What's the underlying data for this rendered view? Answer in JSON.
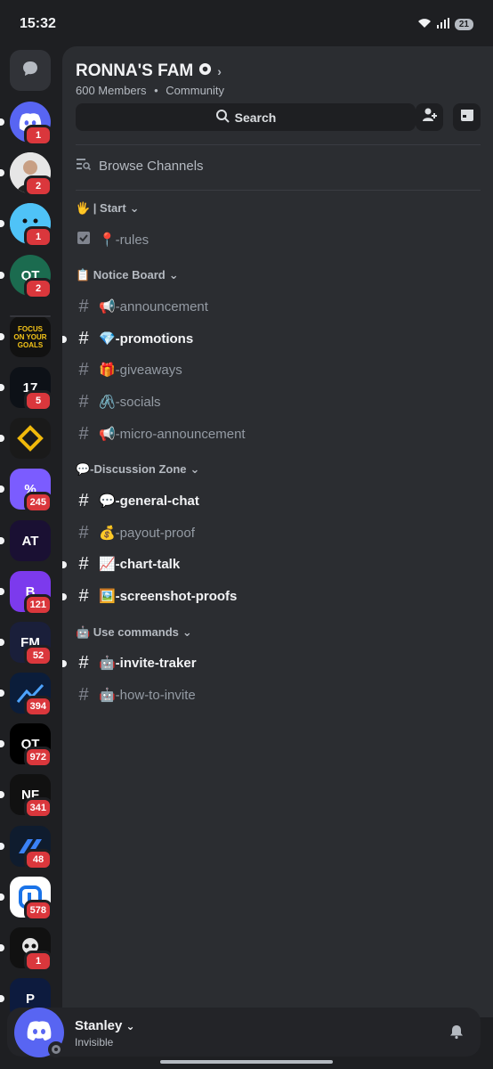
{
  "status_bar": {
    "time": "15:32",
    "battery": "21"
  },
  "rail": {
    "servers": [
      {
        "name": "discord-home",
        "badge": "1",
        "bg": "#5865f2",
        "text": ""
      },
      {
        "name": "user-avatar-2",
        "badge": "2",
        "bg": "#cfcfcf",
        "text": ""
      },
      {
        "name": "user-avatar-3",
        "badge": "1",
        "bg": "#4fc3f7",
        "text": ""
      },
      {
        "name": "qt-server-green",
        "badge": "2",
        "bg": "#1b6b4f",
        "text": "QT"
      },
      {
        "name": "focus-goals-server",
        "badge": "",
        "bg": "#111111",
        "text": "FOCUS ON YOUR GOALS"
      },
      {
        "name": "17-server",
        "badge": "5",
        "bg": "#0d1117",
        "text": "17"
      },
      {
        "name": "orange-logo-server",
        "badge": "",
        "bg": "#1a1a1a",
        "text": ""
      },
      {
        "name": "percent-server",
        "badge": "245",
        "bg": "#7b5cff",
        "text": "%"
      },
      {
        "name": "at-funded-server",
        "badge": "",
        "bg": "#1a1033",
        "text": "AT"
      },
      {
        "name": "b-server",
        "badge": "121",
        "bg": "#7c3aed",
        "text": "B"
      },
      {
        "name": "fm-server",
        "badge": "52",
        "bg": "#1a1f3a",
        "text": "FM"
      },
      {
        "name": "chart-logo-server",
        "badge": "394",
        "bg": "#0b1d3a",
        "text": ""
      },
      {
        "name": "qt-server-black",
        "badge": "972",
        "bg": "#000000",
        "text": "QT"
      },
      {
        "name": "nf-server",
        "badge": "341",
        "bg": "#111111",
        "text": "NF"
      },
      {
        "name": "blue-stripes-server",
        "badge": "48",
        "bg": "#0f1c2e",
        "text": ""
      },
      {
        "name": "in-server",
        "badge": "578",
        "bg": "#ffffff",
        "text": ""
      },
      {
        "name": "skull-server",
        "badge": "1",
        "bg": "#111111",
        "text": ""
      },
      {
        "name": "p-server",
        "badge": "",
        "bg": "#0d1b3e",
        "text": "P"
      }
    ]
  },
  "guild": {
    "name": "RONNA'S FAM",
    "members": "600 Members",
    "type": "Community",
    "search_label": "Search",
    "browse_label": "Browse Channels"
  },
  "categories": [
    {
      "label": "🖐️ | Start"
    },
    {
      "label": "📋 Notice Board"
    },
    {
      "label": "💬-Discussion Zone"
    },
    {
      "label": "🤖 Use commands"
    }
  ],
  "channels": [
    {
      "label": "📍-rules"
    },
    {
      "label": "📢-announcement"
    },
    {
      "label": "💎-promotions"
    },
    {
      "label": "🎁-giveaways"
    },
    {
      "label": "🖇️-socials"
    },
    {
      "label": "📢-micro-announcement"
    },
    {
      "label": "💬-general-chat"
    },
    {
      "label": "💰-payout-proof"
    },
    {
      "label": "📈-chart-talk"
    },
    {
      "label": "🖼️-screenshot-proofs"
    },
    {
      "label": "🤖-invite-traker"
    },
    {
      "label": "🤖-how-to-invite"
    }
  ],
  "user": {
    "name": "Stanley",
    "status": "Invisible"
  },
  "colors": {
    "blurple": "#5865f2",
    "badge_red": "#da373c",
    "panel": "#2b2d31",
    "rail": "#1e1f22"
  }
}
